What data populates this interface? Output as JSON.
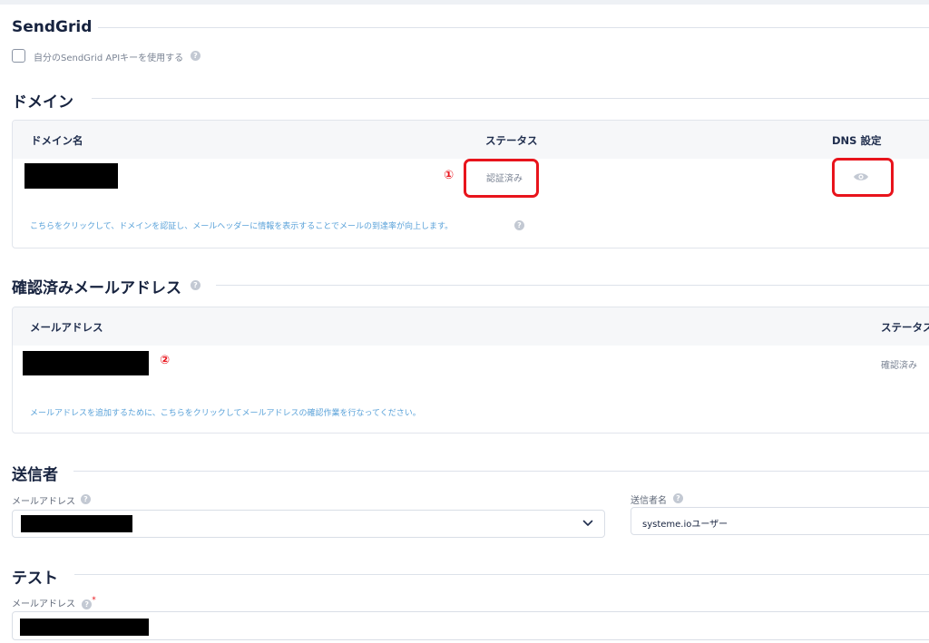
{
  "sendgrid": {
    "title": "SendGrid",
    "use_own_key_label": "自分のSendGrid APIキーを使用する"
  },
  "domain": {
    "title": "ドメイン",
    "columns": [
      "ドメイン名",
      "ステータス",
      "DNS 設定"
    ],
    "row_status": "認証済み",
    "marker": "①",
    "hint": "こちらをクリックして、ドメインを認証し、メールヘッダーに情報を表示することでメールの到達率が向上します。"
  },
  "verified_emails": {
    "title": "確認済みメールアドレス",
    "columns": [
      "メールアドレス",
      "ステータス"
    ],
    "row_status": "確認済み",
    "marker": "②",
    "hint": "メールアドレスを追加するために、こちらをクリックしてメールアドレスの確認作業を行なってください。"
  },
  "sender": {
    "title": "送信者",
    "email_label": "メールアドレス",
    "name_label": "送信者名",
    "name_value": "systeme.ioユーザー"
  },
  "test": {
    "title": "テスト",
    "email_label": "メールアドレス",
    "required_mark": "*"
  },
  "icons": {
    "help": "question-circle-icon",
    "eye": "eye-icon",
    "chevron": "chevron-down-icon"
  },
  "colors": {
    "highlight": "#e8141c",
    "hint": "#5aa2d9",
    "heading": "#17233f"
  }
}
